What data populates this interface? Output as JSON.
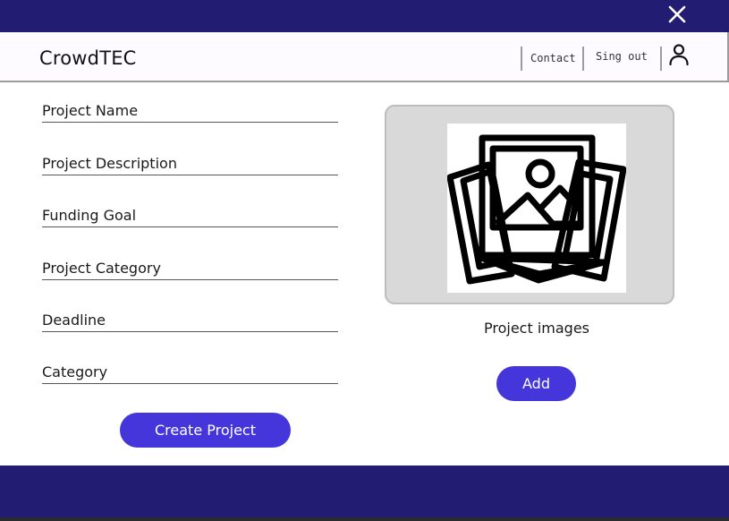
{
  "header": {
    "brand": "CrowdTEC",
    "nav": {
      "contact": "Contact",
      "sign_out": "Sing out"
    },
    "icons": {
      "close": "close-icon",
      "user": "user-icon"
    }
  },
  "form": {
    "fields": [
      {
        "label": "Project Name"
      },
      {
        "label": "Project Description"
      },
      {
        "label": "Funding Goal"
      },
      {
        "label": "Project Category"
      },
      {
        "label": "Deadline"
      },
      {
        "label": "Category"
      }
    ],
    "submit_label": "Create Project"
  },
  "images": {
    "label": "Project images",
    "add_label": "Add",
    "icon": "image-gallery-icon"
  },
  "colors": {
    "bar": "#231c73",
    "accent": "#4536dc",
    "panel": "#d9d9d9"
  }
}
